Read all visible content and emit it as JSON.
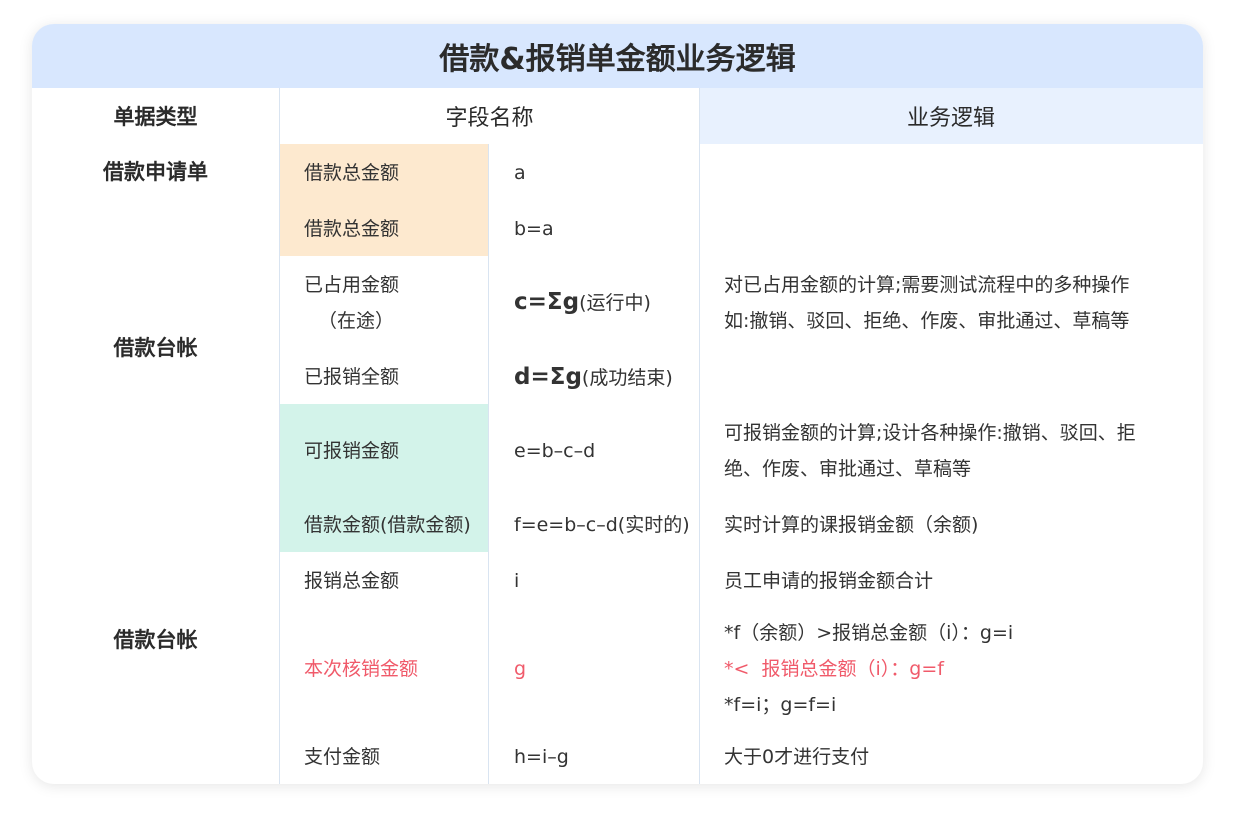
{
  "title": "借款&报销单金额业务逻辑",
  "headers": {
    "type": "单据类型",
    "field": "字段名称",
    "logic": "业务逻辑"
  },
  "types": {
    "loan_application": "借款申请单",
    "loan_ledger_1": "借款台帐",
    "loan_ledger_2": "借款台帐"
  },
  "rows": [
    {
      "field": "借款总金额",
      "value": "a",
      "logic": ""
    },
    {
      "field": "借款总金额",
      "value": "b=a",
      "logic": ""
    },
    {
      "field_line1": "已占用金额",
      "field_line2": "（在途）",
      "value_bold": "c=Σg",
      "value_rest": "(运行中)",
      "logic_line1": "对已占用金额的计算;需要测试流程中的多种操作",
      "logic_line2": "如:撤销、驳回、拒绝、作废、审批通过、草稿等"
    },
    {
      "field": "已报销全额",
      "value_bold": "d=Σg",
      "value_rest": "(成功结束)"
    },
    {
      "field": "可报销金额",
      "value": "e=b–c–d",
      "logic_line1": "可报销金额的计算;设计各种操作:撤销、驳回、拒",
      "logic_line2": "绝、作废、审批通过、草稿等"
    },
    {
      "field": "借款金额(借款金额)",
      "value": "f=e=b–c–d(实时的)",
      "logic": "实时计算的课报销金额（余额)"
    },
    {
      "field": "报销总金额",
      "value": "i",
      "logic": "员工申请的报销金额合计"
    },
    {
      "field": "本次核销金额",
      "value": "g",
      "logic_line1": "*f（余额）>报销总金额（i）：g=i",
      "logic_line2": "*<  报销总金额（i）：g=f",
      "logic_line3": "*f=i；g=f=i"
    },
    {
      "field": "支付金额",
      "value": "h=i–g",
      "logic": "大于0才进行支付"
    }
  ],
  "colors": {
    "title_bg": "#d8e7fe",
    "peach": "#fde9cf",
    "mint": "#d3f3ea",
    "highlight_red": "#f05a6a"
  }
}
